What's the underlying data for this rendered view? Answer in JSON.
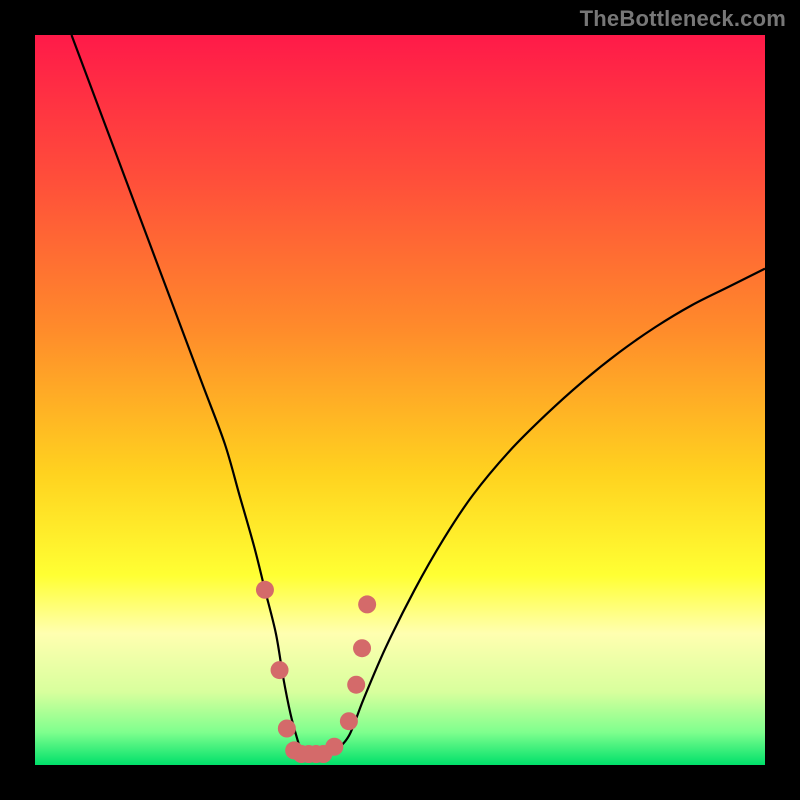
{
  "watermark": "TheBottleneck.com",
  "chart_data": {
    "type": "line",
    "title": "",
    "xlabel": "",
    "ylabel": "",
    "xlim": [
      0,
      100
    ],
    "ylim": [
      0,
      100
    ],
    "background_gradient": {
      "stops": [
        {
          "offset": 0.0,
          "color": "#ff1a49"
        },
        {
          "offset": 0.2,
          "color": "#ff4f3a"
        },
        {
          "offset": 0.4,
          "color": "#ff8a2b"
        },
        {
          "offset": 0.6,
          "color": "#ffd21f"
        },
        {
          "offset": 0.74,
          "color": "#ffff33"
        },
        {
          "offset": 0.82,
          "color": "#ffffb0"
        },
        {
          "offset": 0.9,
          "color": "#d8ff9d"
        },
        {
          "offset": 0.955,
          "color": "#7fff8e"
        },
        {
          "offset": 1.0,
          "color": "#00e06a"
        }
      ]
    },
    "series": [
      {
        "name": "bottleneck-curve",
        "color": "#000000",
        "x": [
          5,
          8,
          11,
          14,
          17,
          20,
          23,
          26,
          28,
          30,
          31.5,
          33,
          34,
          35,
          35.8,
          36.5,
          37.5,
          39,
          41,
          43,
          45,
          48,
          52,
          56,
          60,
          65,
          70,
          75,
          80,
          85,
          90,
          95,
          100
        ],
        "y": [
          100,
          92,
          84,
          76,
          68,
          60,
          52,
          44,
          37,
          30,
          24,
          18,
          12,
          7,
          4,
          2,
          1.5,
          1.5,
          2,
          4,
          9,
          16,
          24,
          31,
          37,
          43,
          48,
          52.5,
          56.5,
          60,
          63,
          65.5,
          68
        ]
      }
    ],
    "markers": {
      "name": "highlight-dots",
      "color": "#d46a6a",
      "radius": 9,
      "points": [
        {
          "x": 31.5,
          "y": 24
        },
        {
          "x": 33.5,
          "y": 13
        },
        {
          "x": 34.5,
          "y": 5
        },
        {
          "x": 35.5,
          "y": 2
        },
        {
          "x": 36.5,
          "y": 1.5
        },
        {
          "x": 37.5,
          "y": 1.5
        },
        {
          "x": 38.5,
          "y": 1.5
        },
        {
          "x": 39.5,
          "y": 1.5
        },
        {
          "x": 41.0,
          "y": 2.5
        },
        {
          "x": 43.0,
          "y": 6
        },
        {
          "x": 44.0,
          "y": 11
        },
        {
          "x": 44.8,
          "y": 16
        },
        {
          "x": 45.5,
          "y": 22
        }
      ]
    }
  }
}
